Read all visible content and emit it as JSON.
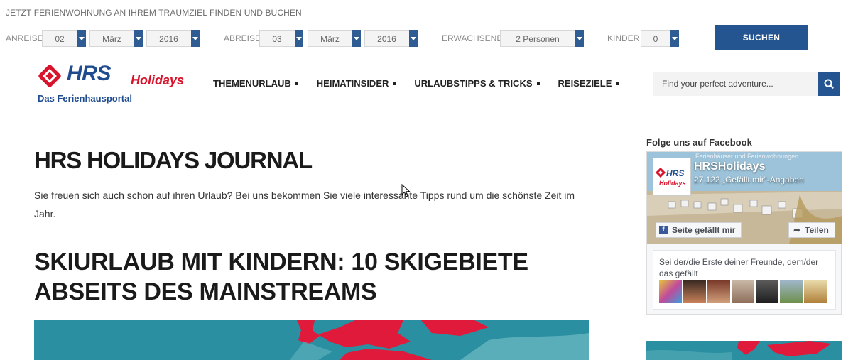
{
  "booking": {
    "title": "JETZT FERIENWOHNUNG AN IHREM TRAUMZIEL FINDEN UND BUCHEN",
    "arrival_label": "ANREISE",
    "arrival_day": "02",
    "arrival_month": "März",
    "arrival_year": "2016",
    "departure_label": "ABREISE",
    "departure_day": "03",
    "departure_month": "März",
    "departure_year": "2016",
    "adults_label": "ERWACHSENE",
    "adults_value": "2 Personen",
    "children_label": "KINDER",
    "children_value": "0",
    "search_label": "SUCHEN"
  },
  "header": {
    "logo_hrs": "HRS",
    "logo_holidays": "Holidays",
    "logo_subtitle": "Das Ferienhausportal",
    "nav": [
      "THEMENURLAUB",
      "HEIMATINSIDER",
      "URLAUBSTIPPS & TRICKS",
      "REISEZIELE"
    ],
    "search_placeholder": "Find your perfect adventure..."
  },
  "main": {
    "journal_title": "HRS HOLIDAYS JOURNAL",
    "intro": "Sie freuen sich auch schon auf ihren Urlaub? Bei uns bekommen Sie viele interessante Tipps rund um die schönste Zeit im Jahr.",
    "article_title": "SKIURLAUB MIT KINDERN: 10 SKIGEBIETE ABSEITS DES MAINSTREAMS"
  },
  "sidebar": {
    "fb_heading": "Folge uns auf Facebook",
    "fb_tagline": "Ferienhäuser und Ferienwohnungen",
    "fb_page_name": "HRSHolidays",
    "fb_likes": "27.122 „Gefällt mir“-Angaben",
    "fb_like_button": "Seite gefällt mir",
    "fb_share_button": "Teilen",
    "fb_friends_text": "Sei der/die Erste deiner Freunde, dem/der das gefällt"
  },
  "colors": {
    "brand_blue": "#245590",
    "brand_red": "#d8142c",
    "map_teal": "#2a8fa1",
    "facebook_blue": "#3b5998"
  }
}
